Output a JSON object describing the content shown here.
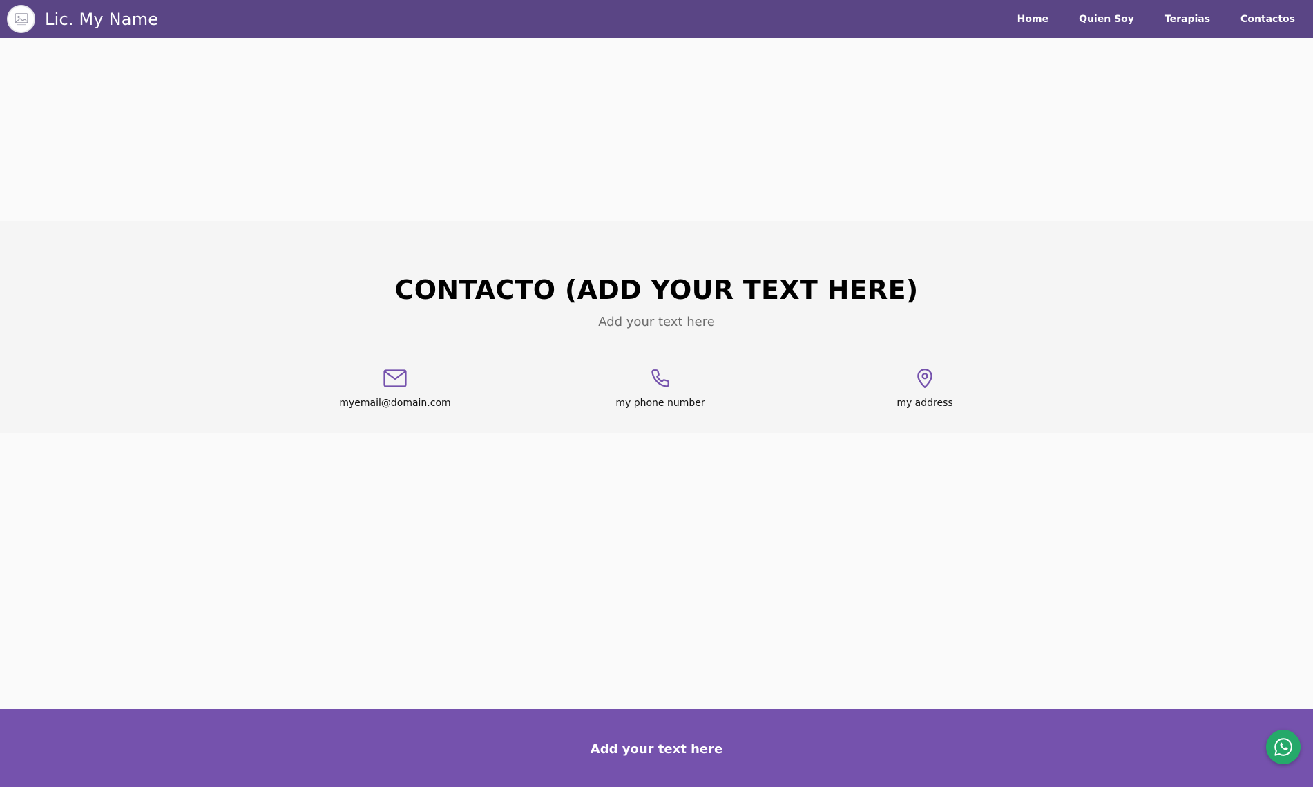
{
  "navbar": {
    "brand": "Lic. My Name",
    "links": [
      {
        "label": "Home"
      },
      {
        "label": "Quien Soy"
      },
      {
        "label": "Terapias"
      },
      {
        "label": "Contactos"
      }
    ]
  },
  "contact": {
    "title": "CONTACTO (ADD YOUR TEXT HERE)",
    "subtitle": "Add your text here",
    "items": [
      {
        "icon": "mail-icon",
        "label": "myemail@domain.com"
      },
      {
        "icon": "phone-icon",
        "label": "my phone number"
      },
      {
        "icon": "map-pin-icon",
        "label": "my address"
      }
    ]
  },
  "footer": {
    "text": "Add your text here"
  },
  "colors": {
    "navbar_bg": "#5a4585",
    "accent": "#7552ad",
    "footer_bg": "#7552ad",
    "whatsapp": "#25a96a"
  }
}
